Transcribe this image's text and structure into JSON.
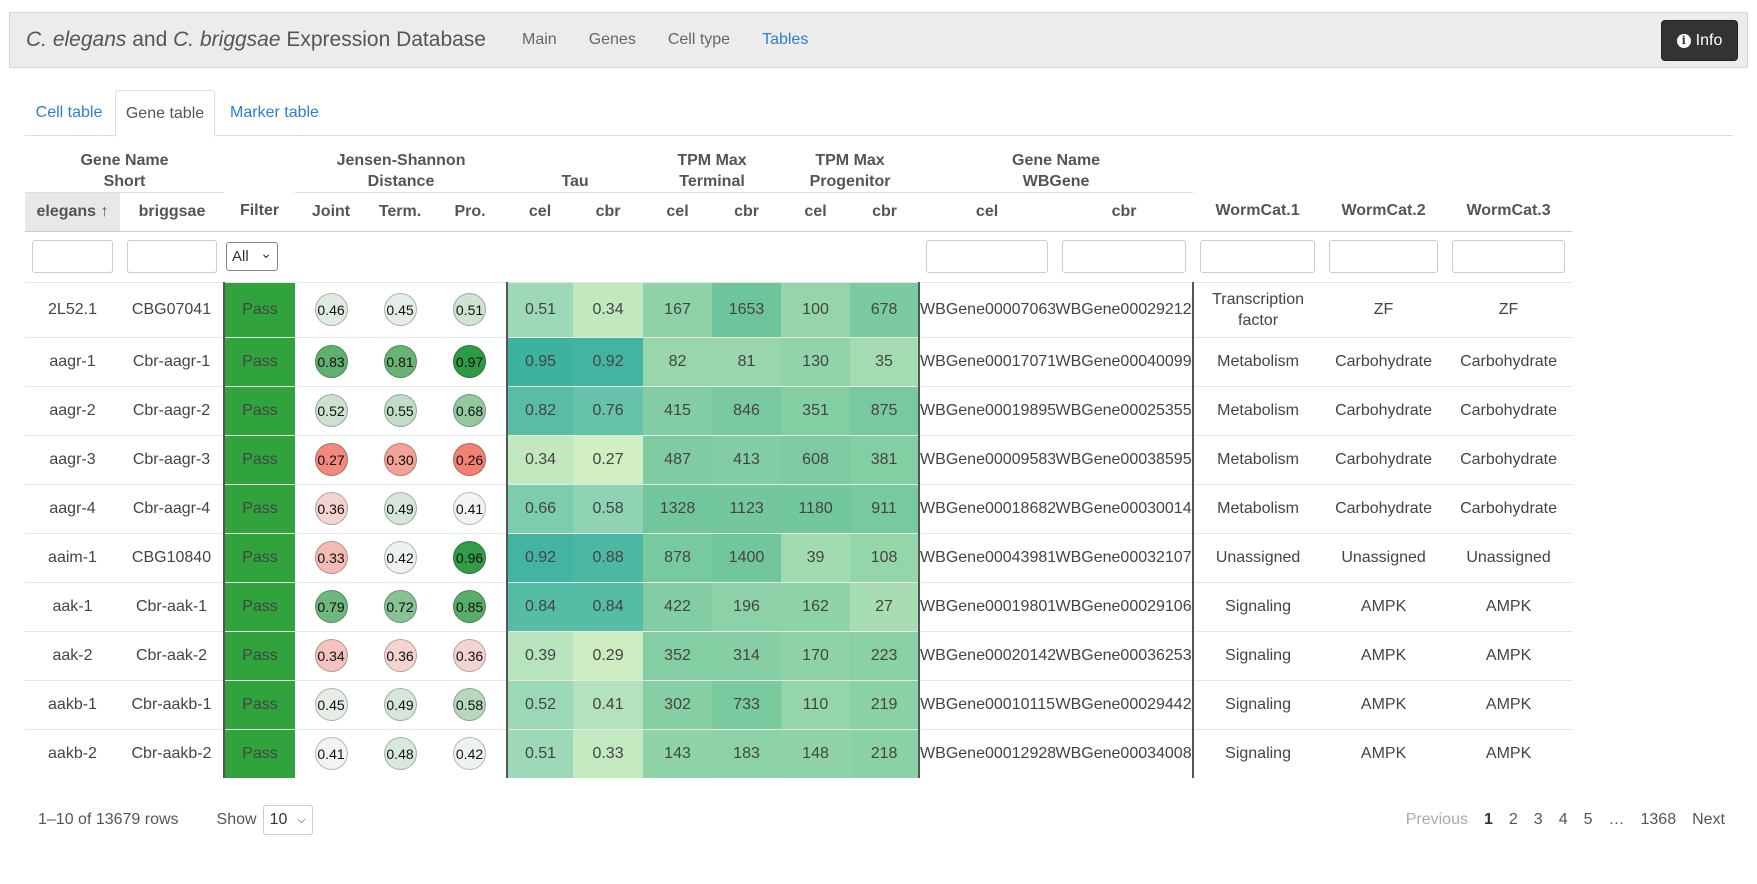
{
  "brand": {
    "species1": "C. elegans",
    "and": "and",
    "species2": "C. briggsae",
    "rest": "Expression Database"
  },
  "nav": [
    {
      "label": "Main",
      "active": false
    },
    {
      "label": "Genes",
      "active": false
    },
    {
      "label": "Cell type",
      "active": false
    },
    {
      "label": "Tables",
      "active": true
    }
  ],
  "info_button": {
    "label": "Info",
    "icon": "info-circle-icon"
  },
  "tabs": [
    {
      "label": "Cell table",
      "active": false
    },
    {
      "label": "Gene table",
      "active": true
    },
    {
      "label": "Marker table",
      "active": false
    }
  ],
  "table": {
    "group_headers": {
      "gene_name_short_1": "Gene Name",
      "gene_name_short_2": "Short",
      "jsd_1": "Jensen-Shannon",
      "jsd_2": "Distance",
      "tau": "Tau",
      "tpm_terminal_1": "TPM Max",
      "tpm_terminal_2": "Terminal",
      "tpm_progenitor_1": "TPM Max",
      "tpm_progenitor_2": "Progenitor",
      "wbgene_1": "Gene Name",
      "wbgene_2": "WBGene"
    },
    "columns": [
      "elegans ↑",
      "briggsae",
      "Filter",
      "Joint",
      "Term.",
      "Pro.",
      "cel",
      "cbr",
      "cel",
      "cbr",
      "cel",
      "cbr",
      "cel",
      "cbr",
      "WormCat.1",
      "WormCat.2",
      "WormCat.3"
    ],
    "filter_select": "All",
    "rows": [
      {
        "elegans": "2L52.1",
        "briggsae": "CBG07041",
        "filter": "Pass",
        "joint": "0.46",
        "term": "0.45",
        "pro": "0.51",
        "tau_cel": "0.51",
        "tau_cbr": "0.34",
        "tt_cel": "167",
        "tt_cbr": "1653",
        "tp_cel": "100",
        "tp_cbr": "678",
        "wb_cel": "WBGene00007063",
        "wb_cbr": "WBGene00029212",
        "wc1": "Transcription factor",
        "wc2": "ZF",
        "wc3": "ZF"
      },
      {
        "elegans": "aagr-1",
        "briggsae": "Cbr-aagr-1",
        "filter": "Pass",
        "joint": "0.83",
        "term": "0.81",
        "pro": "0.97",
        "tau_cel": "0.95",
        "tau_cbr": "0.92",
        "tt_cel": "82",
        "tt_cbr": "81",
        "tp_cel": "130",
        "tp_cbr": "35",
        "wb_cel": "WBGene00017071",
        "wb_cbr": "WBGene00040099",
        "wc1": "Metabolism",
        "wc2": "Carbohydrate",
        "wc3": "Carbohydrate"
      },
      {
        "elegans": "aagr-2",
        "briggsae": "Cbr-aagr-2",
        "filter": "Pass",
        "joint": "0.52",
        "term": "0.55",
        "pro": "0.68",
        "tau_cel": "0.82",
        "tau_cbr": "0.76",
        "tt_cel": "415",
        "tt_cbr": "846",
        "tp_cel": "351",
        "tp_cbr": "875",
        "wb_cel": "WBGene00019895",
        "wb_cbr": "WBGene00025355",
        "wc1": "Metabolism",
        "wc2": "Carbohydrate",
        "wc3": "Carbohydrate"
      },
      {
        "elegans": "aagr-3",
        "briggsae": "Cbr-aagr-3",
        "filter": "Pass",
        "joint": "0.27",
        "term": "0.30",
        "pro": "0.26",
        "tau_cel": "0.34",
        "tau_cbr": "0.27",
        "tt_cel": "487",
        "tt_cbr": "413",
        "tp_cel": "608",
        "tp_cbr": "381",
        "wb_cel": "WBGene00009583",
        "wb_cbr": "WBGene00038595",
        "wc1": "Metabolism",
        "wc2": "Carbohydrate",
        "wc3": "Carbohydrate"
      },
      {
        "elegans": "aagr-4",
        "briggsae": "Cbr-aagr-4",
        "filter": "Pass",
        "joint": "0.36",
        "term": "0.49",
        "pro": "0.41",
        "tau_cel": "0.66",
        "tau_cbr": "0.58",
        "tt_cel": "1328",
        "tt_cbr": "1123",
        "tp_cel": "1180",
        "tp_cbr": "911",
        "wb_cel": "WBGene00018682",
        "wb_cbr": "WBGene00030014",
        "wc1": "Metabolism",
        "wc2": "Carbohydrate",
        "wc3": "Carbohydrate"
      },
      {
        "elegans": "aaim-1",
        "briggsae": "CBG10840",
        "filter": "Pass",
        "joint": "0.33",
        "term": "0.42",
        "pro": "0.96",
        "tau_cel": "0.92",
        "tau_cbr": "0.88",
        "tt_cel": "878",
        "tt_cbr": "1400",
        "tp_cel": "39",
        "tp_cbr": "108",
        "wb_cel": "WBGene00043981",
        "wb_cbr": "WBGene00032107",
        "wc1": "Unassigned",
        "wc2": "Unassigned",
        "wc3": "Unassigned"
      },
      {
        "elegans": "aak-1",
        "briggsae": "Cbr-aak-1",
        "filter": "Pass",
        "joint": "0.79",
        "term": "0.72",
        "pro": "0.85",
        "tau_cel": "0.84",
        "tau_cbr": "0.84",
        "tt_cel": "422",
        "tt_cbr": "196",
        "tp_cel": "162",
        "tp_cbr": "27",
        "wb_cel": "WBGene00019801",
        "wb_cbr": "WBGene00029106",
        "wc1": "Signaling",
        "wc2": "AMPK",
        "wc3": "AMPK"
      },
      {
        "elegans": "aak-2",
        "briggsae": "Cbr-aak-2",
        "filter": "Pass",
        "joint": "0.34",
        "term": "0.36",
        "pro": "0.36",
        "tau_cel": "0.39",
        "tau_cbr": "0.29",
        "tt_cel": "352",
        "tt_cbr": "314",
        "tp_cel": "170",
        "tp_cbr": "223",
        "wb_cel": "WBGene00020142",
        "wb_cbr": "WBGene00036253",
        "wc1": "Signaling",
        "wc2": "AMPK",
        "wc3": "AMPK"
      },
      {
        "elegans": "aakb-1",
        "briggsae": "Cbr-aakb-1",
        "filter": "Pass",
        "joint": "0.45",
        "term": "0.49",
        "pro": "0.58",
        "tau_cel": "0.52",
        "tau_cbr": "0.41",
        "tt_cel": "302",
        "tt_cbr": "733",
        "tp_cel": "110",
        "tp_cbr": "219",
        "wb_cel": "WBGene00010115",
        "wb_cbr": "WBGene00029442",
        "wc1": "Signaling",
        "wc2": "AMPK",
        "wc3": "AMPK"
      },
      {
        "elegans": "aakb-2",
        "briggsae": "Cbr-aakb-2",
        "filter": "Pass",
        "joint": "0.41",
        "term": "0.48",
        "pro": "0.42",
        "tau_cel": "0.51",
        "tau_cbr": "0.33",
        "tt_cel": "143",
        "tt_cbr": "183",
        "tp_cel": "148",
        "tp_cbr": "218",
        "wb_cel": "WBGene00012928",
        "wb_cbr": "WBGene00034008",
        "wc1": "Signaling",
        "wc2": "AMPK",
        "wc3": "AMPK"
      }
    ]
  },
  "footer": {
    "rows_info": "1–10 of 13679 rows",
    "show_label": "Show",
    "page_size": "10",
    "pagination": [
      "Previous",
      "1",
      "2",
      "3",
      "4",
      "5",
      "…",
      "1368",
      "Next"
    ],
    "current_page": "1"
  },
  "colors": {
    "link": "#2b7fd1",
    "pass": "#30a33d",
    "heat_low": "#d6f0c4",
    "heat_high": "#38b09e",
    "bubble_low": "#f2786a",
    "bubble_mid": "#f5f5f5",
    "bubble_high": "#2f9a45"
  }
}
